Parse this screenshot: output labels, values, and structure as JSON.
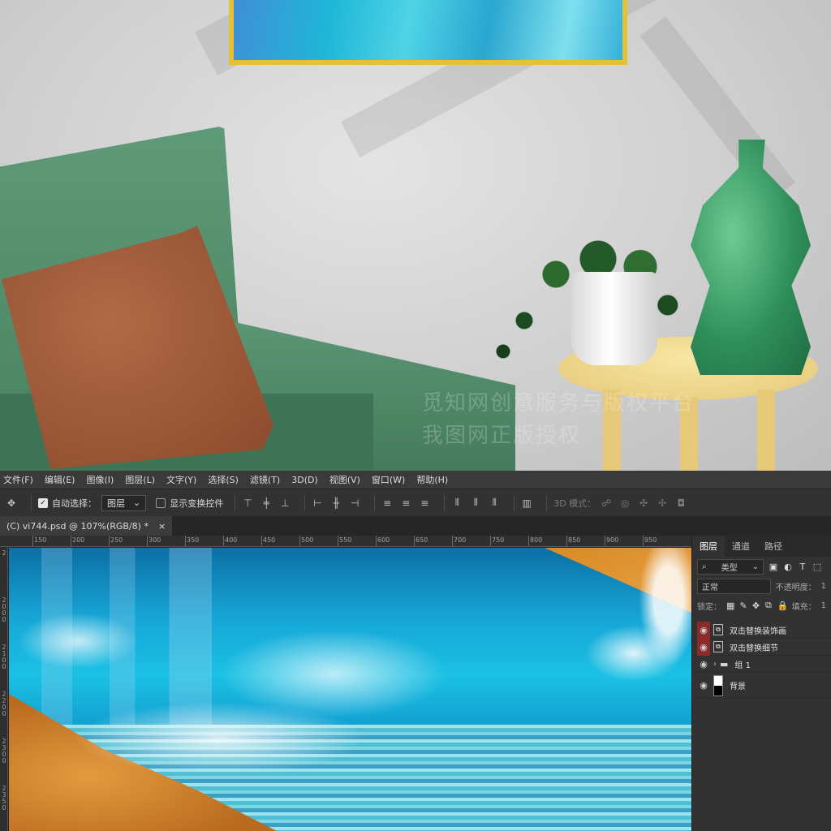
{
  "menu": [
    "文件(F)",
    "编辑(E)",
    "图像(I)",
    "图层(L)",
    "文字(Y)",
    "选择(S)",
    "滤镜(T)",
    "3D(D)",
    "视图(V)",
    "窗口(W)",
    "帮助(H)"
  ],
  "options": {
    "auto_select_label": "自动选择：",
    "auto_select_value": "图层",
    "show_transform_label": "显示变换控件",
    "mode_3d_label": "3D 模式："
  },
  "document": {
    "tab_title": "(C) vi744.psd @ 107%(RGB/8) *",
    "close_glyph": "×"
  },
  "ruler": {
    "h_labels": [
      "150",
      "200",
      "250",
      "300",
      "350",
      "400",
      "450",
      "500",
      "550",
      "600",
      "650",
      "700",
      "750",
      "800",
      "850",
      "900",
      "950"
    ],
    "v_labels": [
      "2",
      "2000",
      "2100",
      "2200",
      "2300",
      "2350"
    ]
  },
  "layers_panel": {
    "tabs": [
      "图层",
      "通道",
      "路径"
    ],
    "filter_label": "类型",
    "blend_mode": "正常",
    "opacity_label": "不透明度：",
    "opacity_value": "1",
    "lock_label": "锁定：",
    "fill_label": "填充：",
    "fill_value": "1",
    "layers": [
      {
        "name": "双击替换装饰画",
        "eye_highlight": true,
        "kind": "smart"
      },
      {
        "name": "双击替换细节",
        "eye_highlight": true,
        "kind": "smart"
      },
      {
        "name": "组 1",
        "eye_highlight": false,
        "kind": "group"
      },
      {
        "name": "背景",
        "eye_highlight": false,
        "kind": "background"
      }
    ]
  },
  "scene_watermark": [
    "觅知网创意服务与版权平台",
    "我图网正版授权"
  ],
  "colors": {
    "ps_bg": "#262626",
    "ps_panel": "#323232",
    "eye_red": "#8c2a2a",
    "frame_gold": "#e3c23a",
    "sofa_green": "#4a8160",
    "pillow_brown": "#9b5535",
    "vase_green": "#2f8f5a"
  }
}
